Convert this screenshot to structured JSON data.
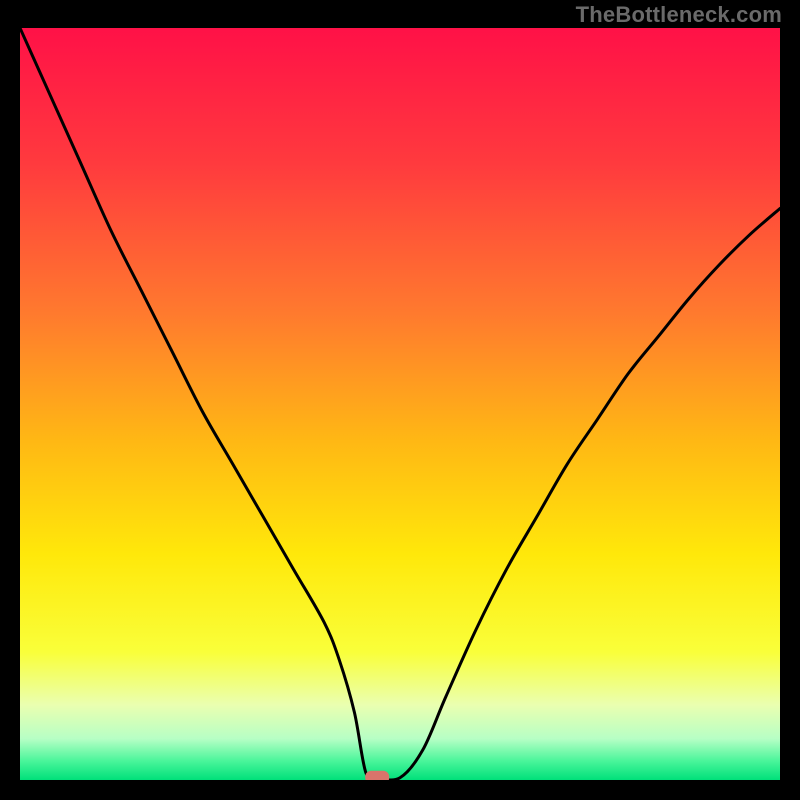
{
  "watermark": "TheBottleneck.com",
  "chart_data": {
    "type": "line",
    "title": "",
    "xlabel": "",
    "ylabel": "",
    "xlim": [
      0,
      100
    ],
    "ylim": [
      0,
      100
    ],
    "series": [
      {
        "name": "curve",
        "x": [
          0,
          4,
          8,
          12,
          16,
          20,
          24,
          28,
          32,
          36,
          40,
          42,
          44,
          45.5,
          47,
          50,
          53,
          56,
          60,
          64,
          68,
          72,
          76,
          80,
          84,
          88,
          92,
          96,
          100
        ],
        "y": [
          100,
          91,
          82,
          73,
          65,
          57,
          49,
          42,
          35,
          28,
          21,
          16,
          9,
          1,
          0.3,
          0.3,
          4,
          11,
          20,
          28,
          35,
          42,
          48,
          54,
          59,
          64,
          68.5,
          72.5,
          76
        ]
      }
    ],
    "marker": {
      "x": 47,
      "y": 0.3,
      "color": "#d9746b"
    },
    "gradient_stops": [
      {
        "offset": 0.0,
        "color": "#ff1147"
      },
      {
        "offset": 0.18,
        "color": "#ff3a3e"
      },
      {
        "offset": 0.38,
        "color": "#ff7a2e"
      },
      {
        "offset": 0.55,
        "color": "#ffb814"
      },
      {
        "offset": 0.7,
        "color": "#ffe80a"
      },
      {
        "offset": 0.83,
        "color": "#f9ff3a"
      },
      {
        "offset": 0.9,
        "color": "#eaffb0"
      },
      {
        "offset": 0.945,
        "color": "#b7ffc5"
      },
      {
        "offset": 0.975,
        "color": "#49f59a"
      },
      {
        "offset": 1.0,
        "color": "#00e07a"
      }
    ]
  }
}
